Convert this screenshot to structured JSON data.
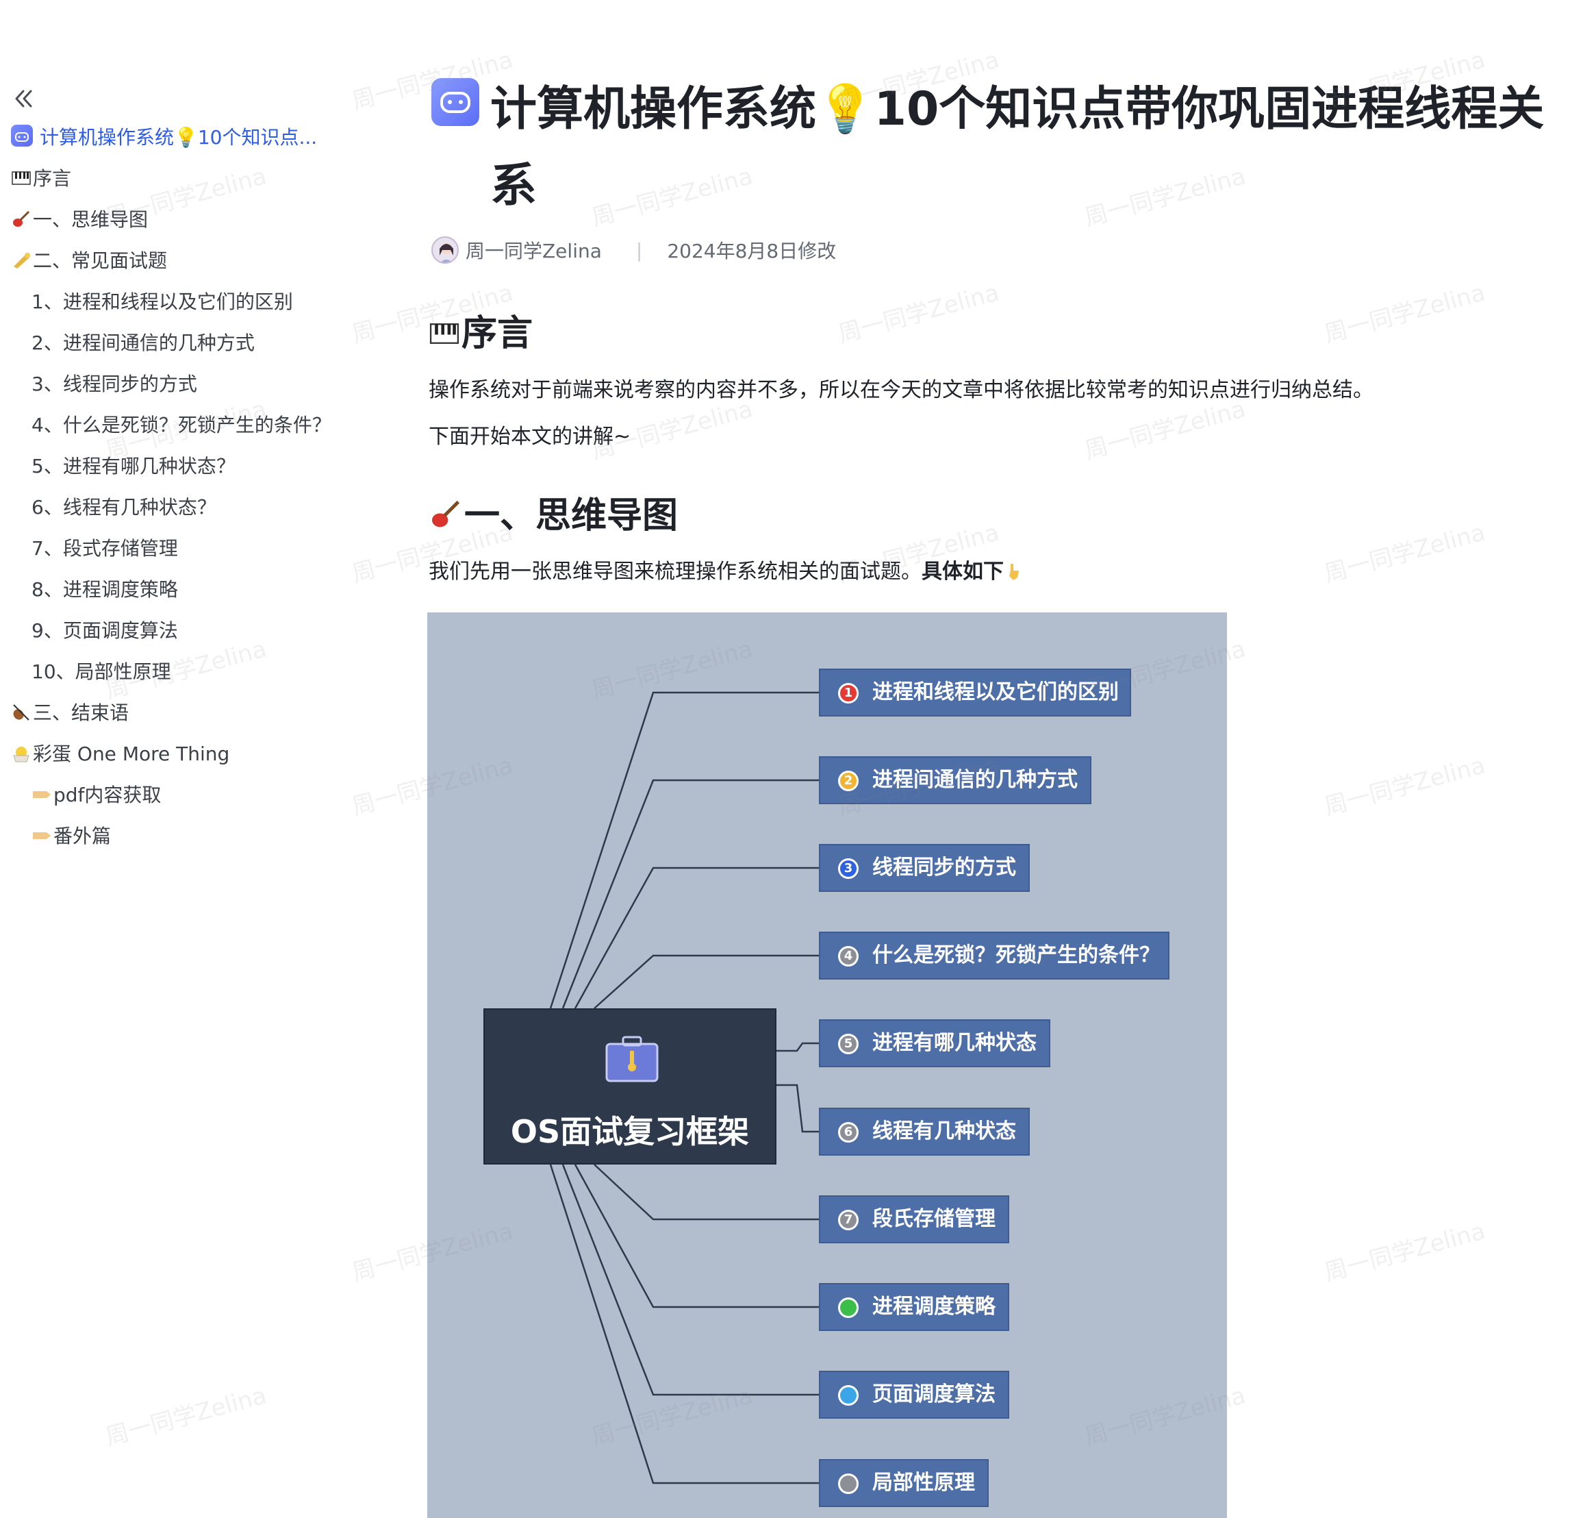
{
  "sidebar": {
    "collapse_icon": "double-chevron-left",
    "items": [
      {
        "label": "计算机操作系统💡10个知识点...",
        "level": 1,
        "icon": "app-icon",
        "active": true
      },
      {
        "label": "序言",
        "level": 1,
        "icon": "piano-emoji"
      },
      {
        "label": "一、思维导图",
        "level": 1,
        "icon": "guitar-emoji"
      },
      {
        "label": "二、常见面试题",
        "level": 1,
        "icon": "trumpet-emoji"
      },
      {
        "label": "1、进程和线程以及它们的区别",
        "level": 2
      },
      {
        "label": "2、进程间通信的几种方式",
        "level": 2
      },
      {
        "label": "3、线程同步的方式",
        "level": 2
      },
      {
        "label": "4、什么是死锁？死锁产生的条件？",
        "level": 2
      },
      {
        "label": "5、进程有哪几种状态？",
        "level": 2
      },
      {
        "label": "6、线程有几种状态？",
        "level": 2
      },
      {
        "label": "7、段式存储管理",
        "level": 2
      },
      {
        "label": "8、进程调度策略",
        "level": 2
      },
      {
        "label": "9、页面调度算法",
        "level": 2
      },
      {
        "label": "10、局部性原理",
        "level": 2
      },
      {
        "label": "三、结束语",
        "level": 1,
        "icon": "violin-emoji"
      },
      {
        "label": "彩蛋 One More Thing",
        "level": 1,
        "icon": "chick-emoji"
      },
      {
        "label": "pdf内容获取",
        "level": 3,
        "icon": "tag-emoji"
      },
      {
        "label": "番外篇",
        "level": 3,
        "icon": "tag-emoji"
      }
    ]
  },
  "doc": {
    "title": "计算机操作系统💡10个知识点带你巩固进程线程关系",
    "author": "周一同学Zelina",
    "modified": "2024年8月8日修改",
    "sections": {
      "preface_heading": "序言",
      "preface_p1": "操作系统对于前端来说考察的内容并不多，所以在今天的文章中将依据比较常考的知识点进行归纳总结。",
      "preface_p2": "下面开始本文的讲解~",
      "mindmap_heading": "一、思维导图",
      "mindmap_intro": "我们先用一张思维导图来梳理操作系统相关的面试题。",
      "mindmap_intro_bold": "具体如下"
    }
  },
  "mindmap": {
    "center": "OS面试复习框架",
    "center_icon": "briefcase-icon",
    "nodes": [
      {
        "num": "1",
        "label": "进程和线程以及它们的区别",
        "badge_color": "#e53935"
      },
      {
        "num": "2",
        "label": "进程间通信的几种方式",
        "badge_color": "#f2b531"
      },
      {
        "num": "3",
        "label": "线程同步的方式",
        "badge_color": "#2d63e0"
      },
      {
        "num": "4",
        "label": "什么是死锁？死锁产生的条件？",
        "badge_color": "#8c8f96"
      },
      {
        "num": "5",
        "label": "进程有哪几种状态",
        "badge_color": "#8c8f96"
      },
      {
        "num": "6",
        "label": "线程有几种状态",
        "badge_color": "#8c8f96"
      },
      {
        "num": "7",
        "label": "段氏存储管理",
        "badge_color": "#8c8f96"
      },
      {
        "num": "",
        "label": "进程调度策略",
        "badge_color": "#3cbf4a"
      },
      {
        "num": "",
        "label": "页面调度算法",
        "badge_color": "#3aa5e8"
      },
      {
        "num": "",
        "label": "局部性原理",
        "badge_color": "#8c8f96"
      }
    ]
  },
  "watermark": "周一同学Zelina"
}
